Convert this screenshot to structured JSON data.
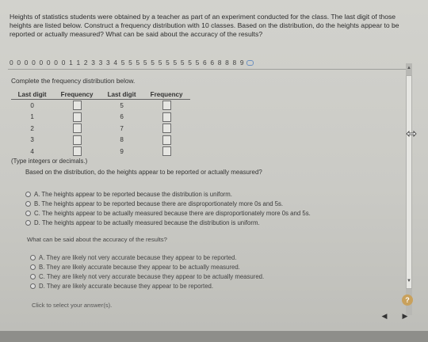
{
  "question": {
    "text": "Heights of statistics students were obtained by a teacher as part of an experiment conducted for the class. The last digit of those heights are listed below. Construct a frequency distribution with 10 classes. Based on the distribution, do the heights appear to be reported or actually measured? What can be said about the accuracy of the results?"
  },
  "data_values": "0 0 0 0 0 0 0 0 1 1 2 3 3 3 4 5 5 5 5 5 5 5 5 5 5 5 6 6 8 8 8 9",
  "instruction": "Complete the frequency distribution below.",
  "table": {
    "headers": [
      "Last digit",
      "Frequency",
      "Last digit",
      "Frequency"
    ],
    "rows": [
      {
        "left": "0",
        "right": "5"
      },
      {
        "left": "1",
        "right": "6"
      },
      {
        "left": "2",
        "right": "7"
      },
      {
        "left": "3",
        "right": "8"
      },
      {
        "left": "4",
        "right": "9"
      }
    ]
  },
  "type_hint": "(Type integers or decimals.)",
  "q1": {
    "prompt": "Based on the distribution, do the heights appear to be reported or actually measured?",
    "options": [
      "A.  The heights appear to be reported because the distribution is uniform.",
      "B.  The heights appear to be reported because there are disproportionately more 0s and 5s.",
      "C.  The heights appear to be actually measured because there are disproportionately more 0s and 5s.",
      "D.  The heights appear to be actually measured because the distribution is uniform."
    ]
  },
  "q2": {
    "prompt": "What can be said about the accuracy of the results?",
    "options": [
      "A.  They are likely not very accurate because they appear to be reported.",
      "B.  They are likely accurate because they appear to be actually measured.",
      "C.  They are likely not very accurate because they appear to be actually measured.",
      "D.  They are likely accurate because they appear to be reported."
    ]
  },
  "footer": {
    "hint": "Click to select your answer(s).",
    "help": "?",
    "prev": "◀",
    "next": "▶"
  },
  "scroll": {
    "up": "▲",
    "down": "▼"
  },
  "colors": {
    "background": "#cacac5",
    "help_button": "#c9a15c"
  }
}
